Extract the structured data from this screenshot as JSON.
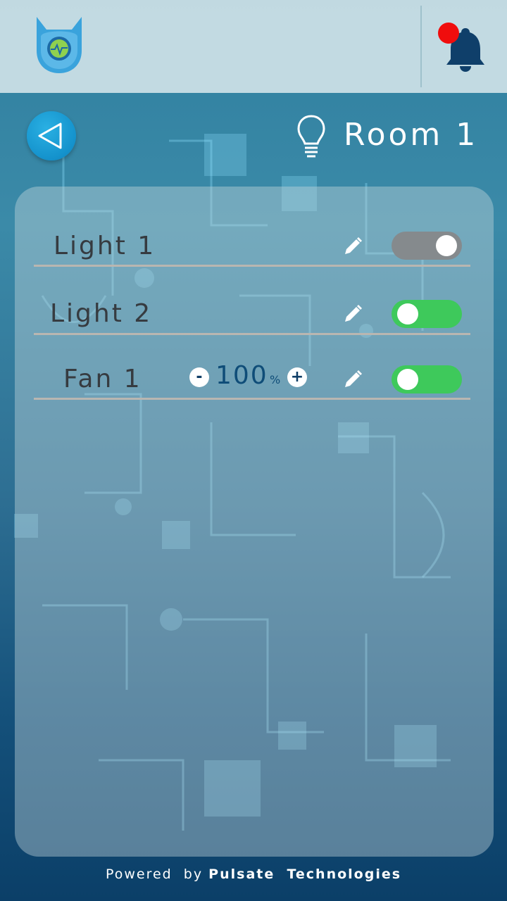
{
  "header": {
    "logo_icon": "owl-pulse-logo-icon",
    "notification_icon": "bell-icon",
    "notification_indicator_color": "#f00d0d"
  },
  "room": {
    "back_icon": "back-triangle-icon",
    "room_icon": "lightbulb-icon",
    "title": "Room 1"
  },
  "devices": [
    {
      "name": "Light 1",
      "edit_icon": "pencil-icon",
      "toggle_state": "off"
    },
    {
      "name": "Light 2",
      "edit_icon": "pencil-icon",
      "toggle_state": "on"
    },
    {
      "name": "Fan 1",
      "edit_icon": "pencil-icon",
      "toggle_state": "on",
      "speed": {
        "value": "100",
        "unit": "%",
        "decrease_label": "-",
        "increase_label": "+"
      }
    }
  ],
  "footer": {
    "prefix": "Powered  by",
    "brand": "Pulsate  Technologies"
  },
  "colors": {
    "toggle_on": "#3ec95b",
    "toggle_off": "#858a8d",
    "accent_blue": "#1492cc"
  }
}
